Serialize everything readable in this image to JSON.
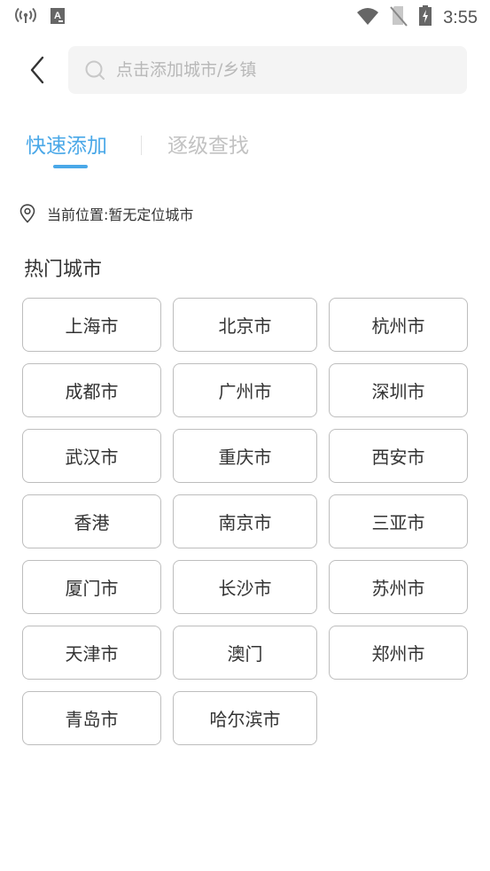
{
  "status_bar": {
    "time": "3:55",
    "left_icons": [
      "hotspot-icon",
      "keyboard-a-icon"
    ],
    "right_icons": [
      "wifi-icon",
      "no-sim-icon",
      "battery-charging-icon"
    ]
  },
  "header": {
    "back_icon": "chevron-left-icon",
    "search": {
      "placeholder": "点击添加城市/乡镇",
      "value": ""
    }
  },
  "tabs": [
    {
      "label": "快速添加",
      "active": true
    },
    {
      "label": "逐级查找",
      "active": false
    }
  ],
  "colors": {
    "accent": "#4aa8e8",
    "inactive_tab": "#c2c2c2",
    "button_border": "#bdbdbd",
    "search_bg": "#f4f4f4"
  },
  "location": {
    "label": "当前位置:",
    "value": "暂无定位城市"
  },
  "hot_cities": {
    "title": "热门城市",
    "items": [
      "上海市",
      "北京市",
      "杭州市",
      "成都市",
      "广州市",
      "深圳市",
      "武汉市",
      "重庆市",
      "西安市",
      "香港",
      "南京市",
      "三亚市",
      "厦门市",
      "长沙市",
      "苏州市",
      "天津市",
      "澳门",
      "郑州市",
      "青岛市",
      "哈尔滨市"
    ]
  }
}
